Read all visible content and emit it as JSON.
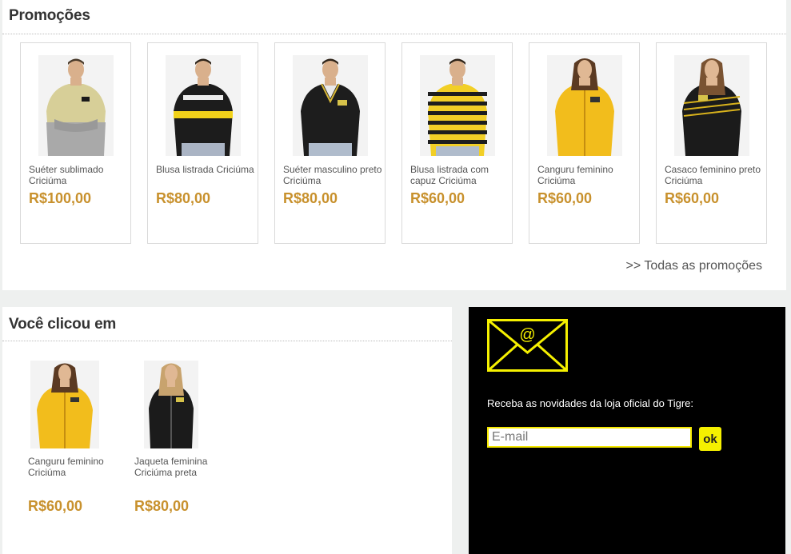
{
  "promotions": {
    "title": "Promoções",
    "all_link": ">> Todas as promoções",
    "items": [
      {
        "name": "Suéter sublimado Criciúma",
        "price": "R$100,00",
        "image": "man-gradient-sweater-photo"
      },
      {
        "name": "Blusa listrada Criciúma",
        "price": "R$80,00",
        "image": "man-striped-sweater-photo"
      },
      {
        "name": "Suéter masculino preto Criciúma",
        "price": "R$80,00",
        "image": "man-black-sweater-photo"
      },
      {
        "name": "Blusa listrada com capuz Criciúma",
        "price": "R$60,00",
        "image": "man-striped-hoodie-photo"
      },
      {
        "name": "Canguru feminino Criciúma",
        "price": "R$60,00",
        "image": "woman-yellow-hoodie-photo"
      },
      {
        "name": "Casaco feminino preto Criciúma",
        "price": "R$60,00",
        "image": "woman-black-coat-photo"
      }
    ]
  },
  "clicked": {
    "title": "Você clicou em",
    "items": [
      {
        "name": "Canguru feminino Criciúma",
        "price": "R$60,00",
        "image": "woman-yellow-hoodie-photo"
      },
      {
        "name": "Jaqueta feminina Criciúma preta",
        "price": "R$80,00",
        "image": "woman-black-jacket-photo"
      }
    ]
  },
  "newsletter": {
    "text": "Receba as novidades da loja oficial do Tigre:",
    "email_placeholder": "E-mail",
    "email_value": "",
    "ok_label": "ok",
    "icon": "mail-icon"
  },
  "colors": {
    "price": "#c8912d",
    "accent_yellow": "#f5e800",
    "newsletter_bg": "#000000"
  }
}
